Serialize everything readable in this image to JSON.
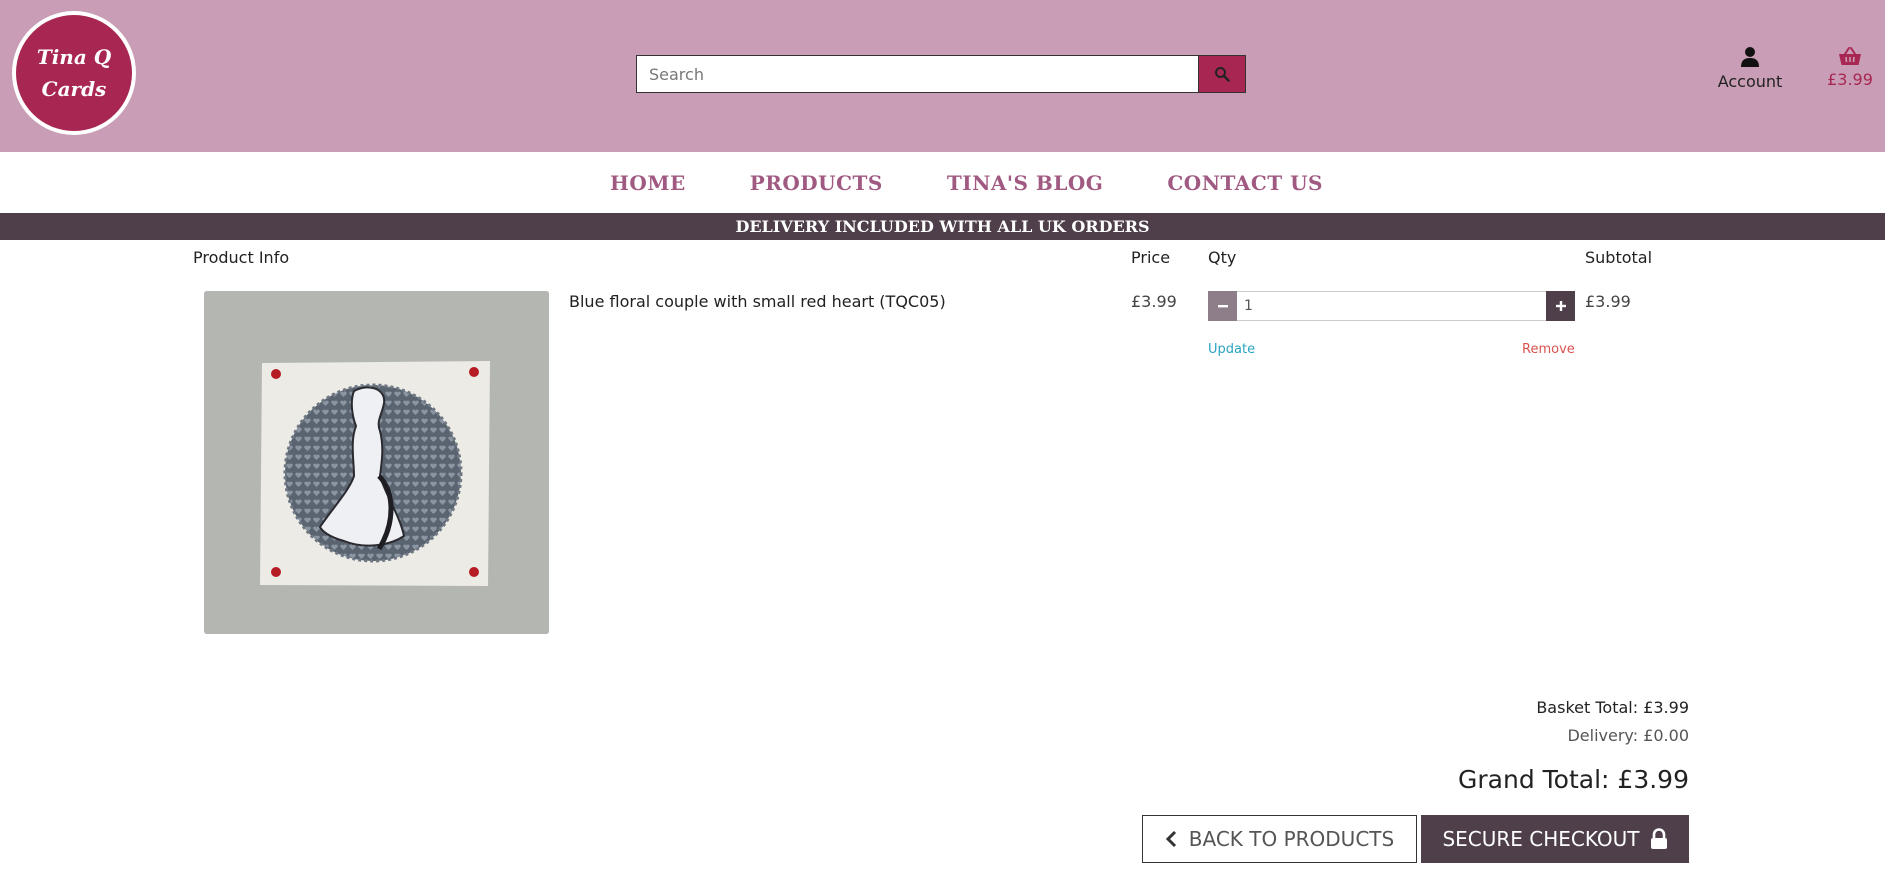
{
  "header": {
    "logo_line1": "Tina Q",
    "logo_line2": "Cards",
    "search_placeholder": "Search",
    "account_label": "Account",
    "basket_amount": "£3.99"
  },
  "nav": {
    "items": [
      "Home",
      "Products",
      "Tina's Blog",
      "Contact Us"
    ]
  },
  "banner": "Delivery included with all UK orders",
  "table": {
    "headers": {
      "product_info": "Product Info",
      "price": "Price",
      "qty": "Qty",
      "subtotal": "Subtotal"
    },
    "row": {
      "product_name": "Blue floral couple with small red heart (TQC05)",
      "price": "£3.99",
      "quantity": "1",
      "subtotal": "£3.99",
      "update_label": "Update",
      "remove_label": "Remove"
    }
  },
  "totals": {
    "basket_total": "Basket Total: £3.99",
    "delivery": "Delivery: £0.00",
    "grand_total": "Grand Total: £3.99"
  },
  "actions": {
    "back_label": "Back to Products",
    "checkout_label": "Secure Checkout"
  },
  "colors": {
    "header_bg": "#c99db5",
    "brand": "#a82752",
    "nav_text": "#a05a82",
    "dark": "#4e3f4a"
  },
  "icons": {
    "search": "search-icon",
    "account": "user-icon",
    "basket": "basket-icon",
    "back": "chevron-left-icon",
    "checkout": "lock-icon"
  }
}
